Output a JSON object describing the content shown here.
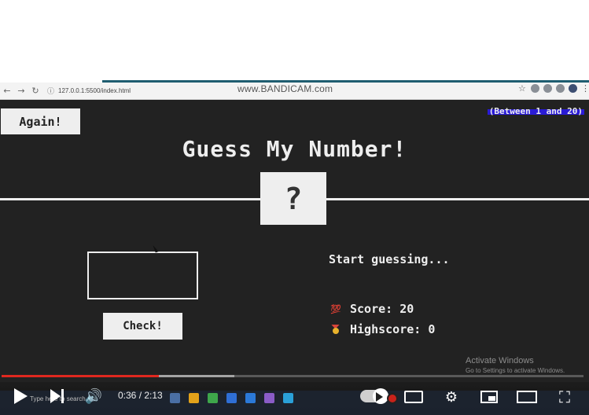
{
  "browser": {
    "url": "127.0.0.1:5500/index.html",
    "watermark": "www.BANDICAM.com"
  },
  "game": {
    "again_label": "Again!",
    "range_hint": "(Between 1 and 20)",
    "title": "Guess My Number!",
    "secret_display": "?",
    "check_label": "Check!",
    "message": "Start guessing...",
    "score_label": "Score:",
    "score_value": "20",
    "highscore_label": "Highscore:",
    "highscore_value": "0",
    "colors": {
      "background": "#222222",
      "foreground": "#eeeeee"
    }
  },
  "overlay": {
    "activate_title": "Activate Windows",
    "activate_sub": "Go to Settings to activate Windows."
  },
  "player": {
    "time": "0:36 / 2:13",
    "played_fraction": 0.27,
    "buffered_fraction": 0.4,
    "accent": "#e0281f"
  },
  "taskbar": {
    "search_hint": "Type here to search"
  }
}
